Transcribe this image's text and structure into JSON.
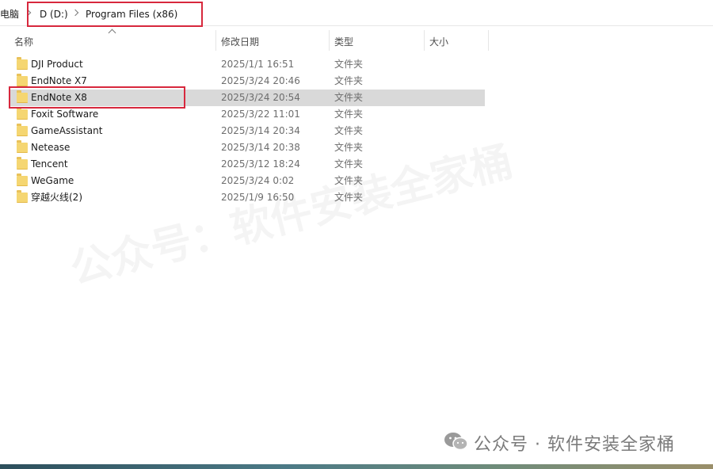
{
  "breadcrumb": {
    "items": [
      "电脑",
      "D (D:)",
      "Program Files (x86)"
    ]
  },
  "columns": {
    "name": "名称",
    "date": "修改日期",
    "type": "类型",
    "size": "大小"
  },
  "rows": [
    {
      "name": "DJI Product",
      "date": "2025/1/1 16:51",
      "type": "文件夹",
      "selected": false
    },
    {
      "name": "EndNote X7",
      "date": "2025/3/24 20:46",
      "type": "文件夹",
      "selected": false
    },
    {
      "name": "EndNote X8",
      "date": "2025/3/24 20:54",
      "type": "文件夹",
      "selected": true
    },
    {
      "name": "Foxit Software",
      "date": "2025/3/22 11:01",
      "type": "文件夹",
      "selected": false
    },
    {
      "name": "GameAssistant",
      "date": "2025/3/14 20:34",
      "type": "文件夹",
      "selected": false
    },
    {
      "name": "Netease",
      "date": "2025/3/14 20:38",
      "type": "文件夹",
      "selected": false
    },
    {
      "name": "Tencent",
      "date": "2025/3/12 18:24",
      "type": "文件夹",
      "selected": false
    },
    {
      "name": "WeGame",
      "date": "2025/3/24 0:02",
      "type": "文件夹",
      "selected": false
    },
    {
      "name": "穿越火线(2)",
      "date": "2025/1/9 16:50",
      "type": "文件夹",
      "selected": false
    }
  ],
  "watermark": {
    "diagonal": "公众号：软件安装全家桶",
    "footer": "公众号 · 软件安装全家桶"
  },
  "colors": {
    "highlight_box": "#d7283d",
    "selected_row": "#d9d9d9",
    "folder": "#f5d672"
  },
  "icons": {
    "folder": "folder-icon",
    "chevron": "chevron-right-icon",
    "sort": "sort-ascending-icon",
    "wechat": "wechat-icon"
  }
}
